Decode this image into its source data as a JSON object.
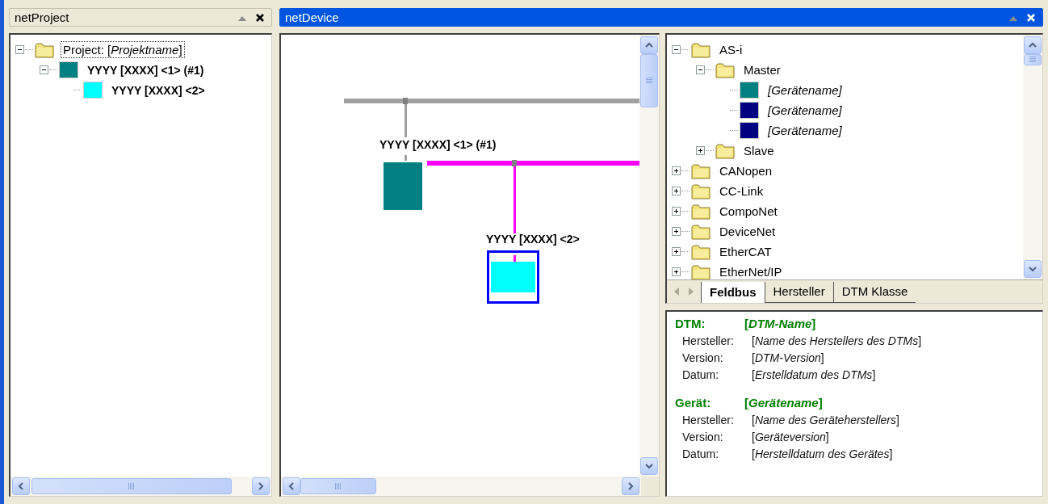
{
  "project_panel": {
    "title": "netProject",
    "active": false,
    "tree": [
      {
        "label": "Project: [*Projektname*]",
        "kind": "folder",
        "expanded": true,
        "selected": true,
        "children": [
          {
            "label": "YYYY [XXXX] <1> (#1)",
            "kind": "device",
            "color": "#008080",
            "expanded": true,
            "selected": false,
            "children": [
              {
                "label": "YYYY [XXXX] <2>",
                "kind": "device",
                "color": "#00ffff",
                "selected": false
              }
            ]
          }
        ]
      }
    ]
  },
  "device_panel": {
    "title": "netDevice",
    "active": true,
    "diagram": {
      "buses": [
        {
          "color": "#a0a0a0"
        },
        {
          "color": "#ff00ff"
        }
      ],
      "devices": [
        {
          "label": "YYYY [XXXX] <1> (#1)",
          "color": "#008080",
          "selected": false
        },
        {
          "label": "YYYY [XXXX] <2>",
          "color": "#00ffff",
          "selected": true
        }
      ]
    },
    "catalog": {
      "tree": [
        {
          "label": "AS-i",
          "kind": "folder",
          "expanded": true,
          "selected": false,
          "children": [
            {
              "label": "Master",
              "kind": "folder",
              "expanded": true,
              "selected": false,
              "children": [
                {
                  "label": "[Gerätename]",
                  "kind": "device",
                  "color": "#008080",
                  "selected": false
                },
                {
                  "label": "[Gerätename]",
                  "kind": "device",
                  "color": "#000080",
                  "selected": false
                },
                {
                  "label": "[Gerätename]",
                  "kind": "device",
                  "color": "#000080",
                  "selected": false
                }
              ]
            },
            {
              "label": "Slave",
              "kind": "folder",
              "expanded": false,
              "selected": false
            }
          ]
        },
        {
          "label": "CANopen",
          "kind": "folder",
          "expanded": false,
          "selected": false
        },
        {
          "label": "CC-Link",
          "kind": "folder",
          "expanded": false,
          "selected": false
        },
        {
          "label": "CompoNet",
          "kind": "folder",
          "expanded": false,
          "selected": false
        },
        {
          "label": "DeviceNet",
          "kind": "folder",
          "expanded": false,
          "selected": false
        },
        {
          "label": "EtherCAT",
          "kind": "folder",
          "expanded": false,
          "selected": false
        },
        {
          "label": "EtherNet/IP",
          "kind": "folder",
          "expanded": false,
          "selected": false
        }
      ],
      "tabs": [
        {
          "label": "Feldbus",
          "selected": true
        },
        {
          "label": "Hersteller",
          "selected": false
        },
        {
          "label": "DTM Klasse",
          "selected": false
        }
      ]
    },
    "info": {
      "sections": [
        {
          "heading": "DTM:",
          "value": "[*DTM-Name*]",
          "fields": [
            {
              "label": "Hersteller:",
              "value": "[*Name des Herstellers des DTMs*]"
            },
            {
              "label": "Version:",
              "value": "[*DTM-Version*]"
            },
            {
              "label": "Datum:",
              "value": "[*Erstelldatum des DTMs*]"
            }
          ]
        },
        {
          "heading": "Gerät:",
          "value": "[*Gerätename*]",
          "fields": [
            {
              "label": "Hersteller:",
              "value": "[*Name des Geräteherstellers*]"
            },
            {
              "label": "Version:",
              "value": "[*Geräteversion*]"
            },
            {
              "label": "Datum:",
              "value": "[*Herstelldatum des Gerätes*]"
            }
          ]
        }
      ]
    }
  }
}
